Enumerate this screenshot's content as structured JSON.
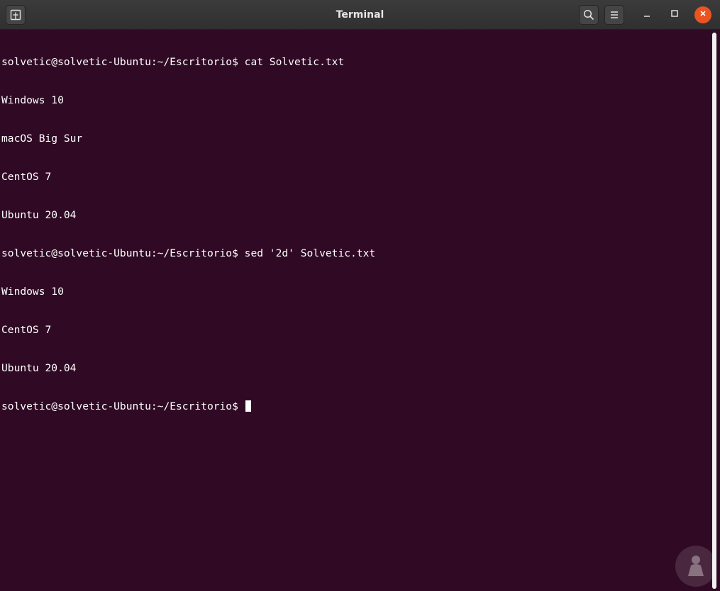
{
  "window": {
    "title": "Terminal"
  },
  "terminal": {
    "lines": [
      "solvetic@solvetic-Ubuntu:~/Escritorio$ cat Solvetic.txt",
      "Windows 10",
      "macOS Big Sur",
      "CentOS 7",
      "Ubuntu 20.04",
      "solvetic@solvetic-Ubuntu:~/Escritorio$ sed '2d' Solvetic.txt",
      "Windows 10",
      "CentOS 7",
      "Ubuntu 20.04"
    ],
    "prompt": "solvetic@solvetic-Ubuntu:~/Escritorio$ "
  },
  "icons": {
    "new_tab": "new-tab-icon",
    "search": "search-icon",
    "menu": "hamburger-menu-icon",
    "minimize": "minimize-icon",
    "maximize": "maximize-icon",
    "close": "close-icon",
    "watermark": "person-watermark-icon"
  },
  "colors": {
    "terminal_bg": "#300a24",
    "titlebar_bg": "#303030",
    "text": "#ffffff",
    "close_accent": "#e95420"
  }
}
